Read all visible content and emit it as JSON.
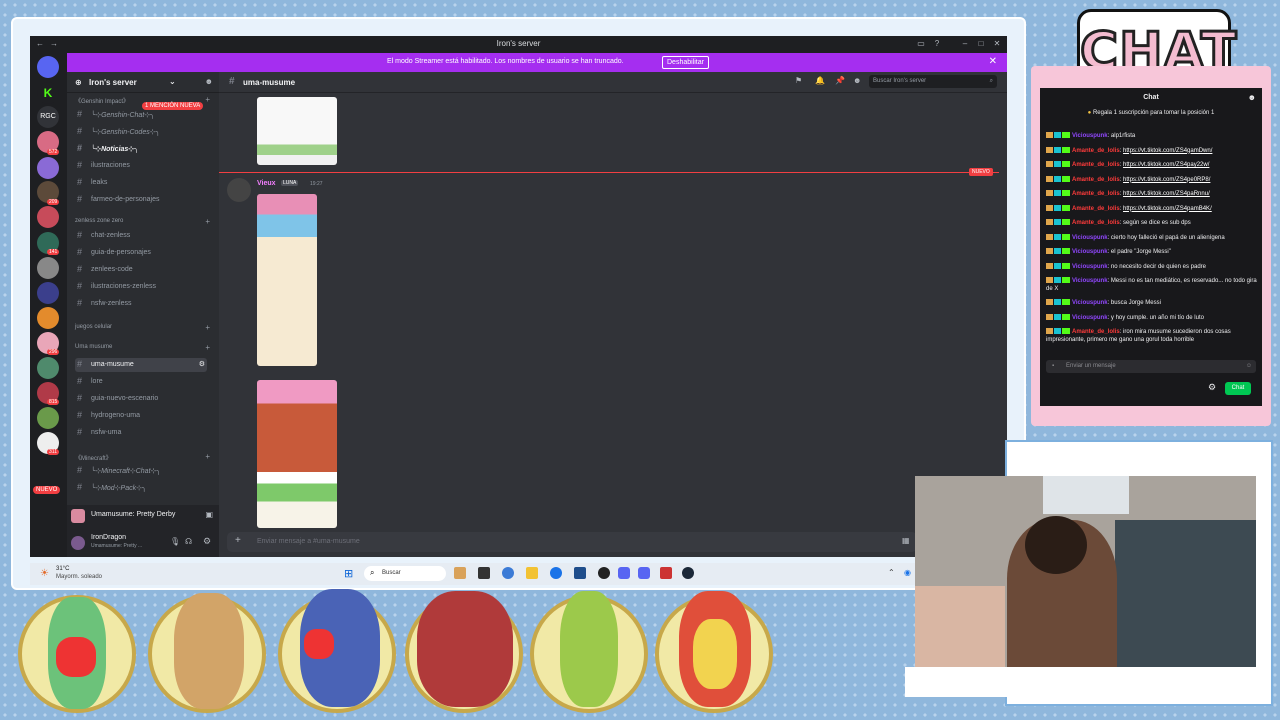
{
  "window": {
    "title": "Iron's server"
  },
  "banner": {
    "message": "El modo Streamer está habilitado. Los nombres de usuario se han truncado.",
    "button": "Deshabilitar"
  },
  "server": {
    "name": "Iron's server",
    "mention_badge": "1 MENCIÓN NUEVA",
    "nuevo_badge": "NUEVO"
  },
  "guild_badges": [
    "572",
    "209",
    "141",
    "296",
    "815",
    "311"
  ],
  "sidebar": {
    "categories": {
      "genshin": "《Genshin Impact》",
      "zenless": "zenless zone zero",
      "juegos": "juegos celular",
      "uma": "Uma musume",
      "minecraft": "《Minecraft》"
    },
    "channels": [
      {
        "label": "╰⊹Genshin-Chat⊹╮"
      },
      {
        "label": "╰⊹Genshin-Codes⊹╮"
      },
      {
        "label": "╰⊹Noticias⊹╮"
      },
      {
        "label": "ilustraciones"
      },
      {
        "label": "leaks"
      },
      {
        "label": "farmeo-de-personajes"
      },
      {
        "label": "chat-zenless"
      },
      {
        "label": "guia-de-personajes"
      },
      {
        "label": "zenlees-code"
      },
      {
        "label": "ilustraciones-zenless"
      },
      {
        "label": "nsfw-zenless"
      },
      {
        "label": "uma-musume"
      },
      {
        "label": "lore"
      },
      {
        "label": "guia-nuevo-escenario"
      },
      {
        "label": "hydrogeno-uma"
      },
      {
        "label": "nsfw-uma"
      },
      {
        "label": "╰⊹Minecraft⊹Chat⊹╮"
      },
      {
        "label": "╰⊹Mod⊹Pack⊹╮"
      }
    ]
  },
  "activity": {
    "title": "Umamusume: Pretty Derby"
  },
  "user": {
    "name": "IronDragon",
    "status": "Umamusume: Pretty ..."
  },
  "channel": {
    "name": "uma-musume"
  },
  "search": {
    "placeholder": "Buscar Iron's server"
  },
  "message": {
    "author": "Vieux",
    "tag": "LUNA",
    "time": "19:27",
    "new_label": "NUEVO"
  },
  "composer": {
    "placeholder": "Enviar mensaje a #uma-musume"
  },
  "taskbar": {
    "weather_temp": "31°C",
    "weather_desc": "Mayorm. soleado",
    "search": "Buscar"
  },
  "stream_overlay": {
    "logo": "CHAT"
  },
  "chat": {
    "title": "Chat",
    "sub_prompt": "Regala 1 suscripción para tomar la posición 1",
    "messages": [
      {
        "user": "Viciouspunk",
        "utype": "u1",
        "text": "alp1rfista",
        "link": false
      },
      {
        "user": "Amante_de_lolis",
        "utype": "u2",
        "text": "https://vt.tiktok.com/ZS4gamDwn/",
        "link": true
      },
      {
        "user": "Amante_de_lolis",
        "utype": "u2",
        "text": "https://vt.tiktok.com/ZS4pay22w/",
        "link": true
      },
      {
        "user": "Amante_de_lolis",
        "utype": "u2",
        "text": "https://vt.tiktok.com/ZS4pe0RP8/",
        "link": true
      },
      {
        "user": "Amante_de_lolis",
        "utype": "u2",
        "text": "https://vt.tiktok.com/ZS4paRnnu/",
        "link": true
      },
      {
        "user": "Amante_de_lolis",
        "utype": "u2",
        "text": "https://vt.tiktok.com/ZS4pamB4K/",
        "link": true
      },
      {
        "user": "Amante_de_lolis",
        "utype": "u2",
        "text": "según se dice es sub dps",
        "link": false
      },
      {
        "user": "Viciouspunk",
        "utype": "u1",
        "text": "cierto hoy falleció el papá de un alienígena",
        "link": false
      },
      {
        "user": "Viciouspunk",
        "utype": "u1",
        "text": "el padre \"Jorge Messi\"",
        "link": false
      },
      {
        "user": "Viciouspunk",
        "utype": "u1",
        "text": "no necesito decir de quien es padre",
        "link": false
      },
      {
        "user": "Viciouspunk",
        "utype": "u1",
        "text": "Messi no es tan mediático, es reservado... no todo gira de X",
        "link": false
      },
      {
        "user": "Viciouspunk",
        "utype": "u1",
        "text": "busca Jorge Messi",
        "link": false
      },
      {
        "user": "Viciouspunk",
        "utype": "u1",
        "text": "y hoy cumple. un año mi tío de luto",
        "link": false
      },
      {
        "user": "Amante_de_lolis",
        "utype": "u2",
        "text": "iron mira musume sucedieron dos cosas impresionante, primero me gano una gorul toda horrible",
        "link": false
      }
    ],
    "input_placeholder": "Enviar un mensaje",
    "send_label": "Chat"
  },
  "colors": {
    "discord_bg": "#313338",
    "sidebar_bg": "#2b2d31",
    "banner": "#a52ef0",
    "unread_red": "#f23f42",
    "chat_send": "#00c853"
  }
}
